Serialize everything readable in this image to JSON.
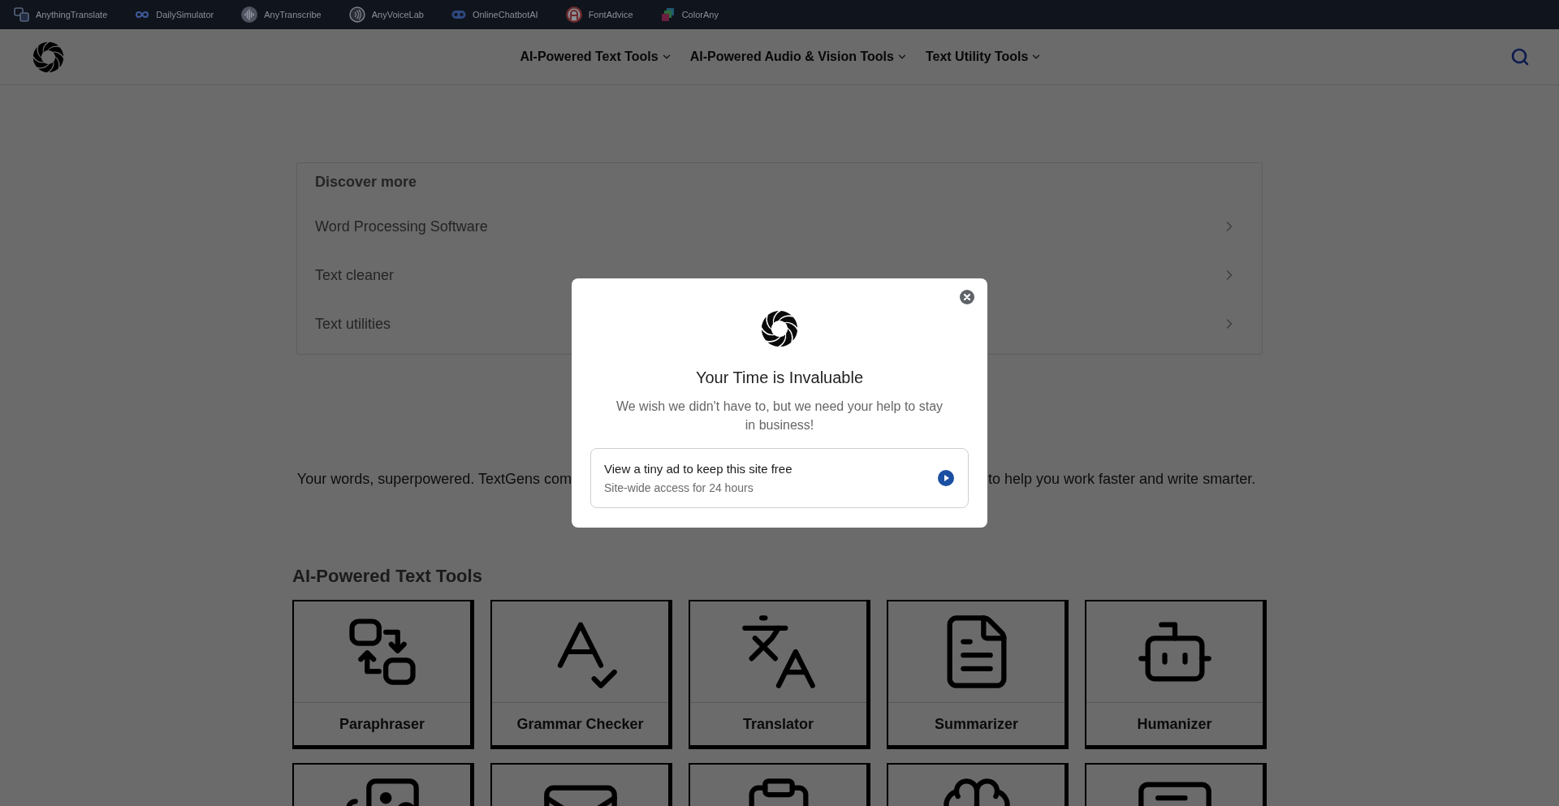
{
  "top_bar": {
    "sites": [
      {
        "label": "AnythingTranslate",
        "kind": "translate"
      },
      {
        "label": "DailySimulator",
        "kind": "infinity"
      },
      {
        "label": "AnyTranscribe",
        "kind": "waveform"
      },
      {
        "label": "AnyVoiceLab",
        "kind": "voice"
      },
      {
        "label": "OnlineChatbotAI",
        "kind": "chatbot"
      },
      {
        "label": "FontAdvice",
        "kind": "font"
      },
      {
        "label": "ColorAny",
        "kind": "palette"
      }
    ]
  },
  "header": {
    "nav": [
      {
        "label": "AI-Powered Text Tools"
      },
      {
        "label": "AI-Powered Audio & Vision Tools"
      },
      {
        "label": "Text Utility Tools"
      }
    ]
  },
  "discover_more": {
    "title": "Discover more",
    "items": [
      "Word Processing Software",
      "Text cleaner",
      "Text utilities"
    ]
  },
  "intro": {
    "visible_left": "Your words, superpowered. TextGens com",
    "visible_right": "to help you work faster and write smarter."
  },
  "tools_section": {
    "title": "AI-Powered Text Tools",
    "cards": [
      {
        "label": "Paraphraser",
        "kind": "swap"
      },
      {
        "label": "Grammar Checker",
        "kind": "spellcheck"
      },
      {
        "label": "Translator",
        "kind": "translate"
      },
      {
        "label": "Summarizer",
        "kind": "document"
      },
      {
        "label": "Humanizer",
        "kind": "bot"
      },
      {
        "kind": "images"
      },
      {
        "kind": "mail"
      },
      {
        "kind": "clipboard"
      },
      {
        "kind": "brain"
      },
      {
        "kind": "note"
      }
    ]
  },
  "modal": {
    "title": "Your Time is Invaluable",
    "message": "We wish we didn't have to, but we need your help to stay in business!",
    "option": {
      "title": "View a tiny ad to keep this site free",
      "subtitle": "Site-wide access for 24 hours"
    }
  }
}
